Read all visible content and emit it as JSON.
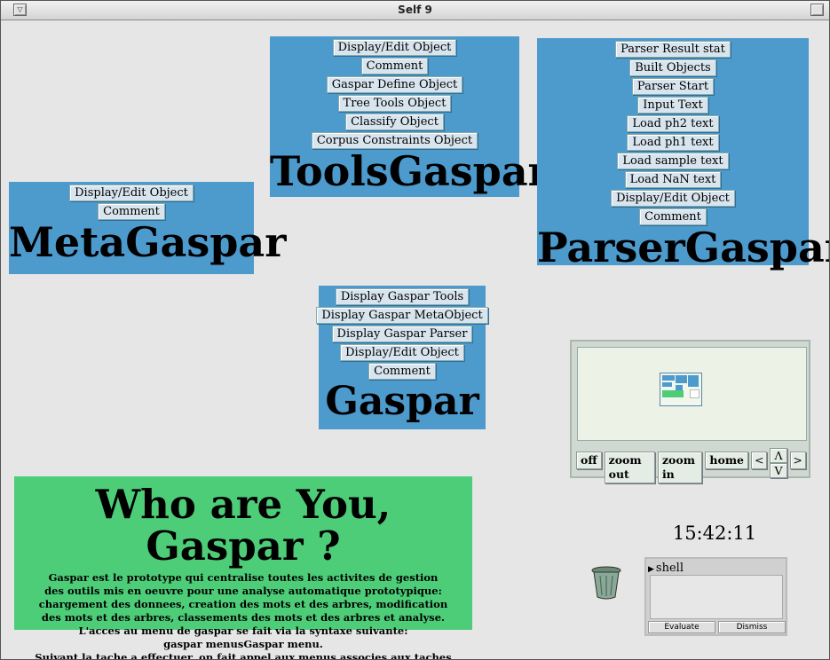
{
  "window": {
    "title": "Self 9",
    "menu_icon": "menu-triangle-icon"
  },
  "tools_gaspar": {
    "items": [
      "Display/Edit Object",
      "Comment",
      "Gaspar Define Object",
      "Tree Tools Object",
      "Classify Object",
      "Corpus Constraints Object"
    ],
    "name": "ToolsGaspar"
  },
  "parser_gaspar": {
    "items": [
      "Parser Result stat",
      "Built Objects",
      "Parser Start",
      "Input Text",
      "Load ph2 text",
      "Load ph1 text",
      "Load sample text",
      "Load NaN text",
      "Display/Edit Object",
      "Comment"
    ],
    "name": "ParserGaspar"
  },
  "meta_gaspar": {
    "items": [
      "Display/Edit Object",
      "Comment"
    ],
    "name": "MetaGaspar"
  },
  "gaspar": {
    "items": [
      "Display Gaspar Tools",
      "Display Gaspar MetaObject",
      "Display Gaspar Parser",
      "Display/Edit Object",
      "Comment"
    ],
    "name": "Gaspar"
  },
  "info": {
    "title": "Who are You, Gaspar ?",
    "lines": [
      "Gaspar est le prototype qui centralise toutes les activites de gestion",
      "des outils mis en oeuvre pour une analyse automatique prototypique:",
      "chargement des donnees, creation des mots et des arbres, modification",
      "des mots et des arbres, classements des mots et des arbres et analyse.",
      "L'acces au menu de gaspar se fait via la syntaxe suivante:",
      "gaspar menusGaspar menu.",
      "Suivant la tache a effectuer, on fait appel aux menus associes aux taches visees."
    ]
  },
  "navigator": {
    "off": "off",
    "zoom_out": "zoom out",
    "zoom_in": "zoom in",
    "home": "home",
    "left": "<",
    "up": "Λ",
    "down": "V",
    "right": ">"
  },
  "clock": {
    "time": "15:42:11"
  },
  "shell": {
    "title": "shell",
    "evaluate": "Evaluate",
    "dismiss": "Dismiss"
  },
  "colors": {
    "panel_blue": "#4d9acd",
    "info_green": "#4dcd78",
    "background": "#e6e6e6"
  }
}
